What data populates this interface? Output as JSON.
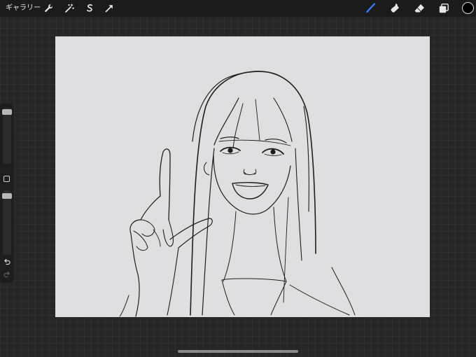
{
  "topbar": {
    "gallery_label": "ギャラリー",
    "left_tools": [
      "wrench-icon",
      "magic-wand-icon",
      "selection-icon",
      "transform-arrow-icon"
    ],
    "right_tools": [
      "brush-icon",
      "smudge-icon",
      "eraser-icon",
      "layers-icon"
    ],
    "active_tool": "brush-icon",
    "colors": {
      "active_tool": "#3d7bff",
      "current_color": "#000000",
      "icon": "#e6e6e6"
    }
  },
  "sidebar": {
    "brush_size_level": 0.95,
    "opacity_level": 1.0,
    "icons": [
      "modify-square-icon",
      "undo-icon",
      "redo-icon"
    ]
  },
  "canvas": {
    "content": "pencil-sketch-artwork",
    "background": "#dfdfe1"
  }
}
